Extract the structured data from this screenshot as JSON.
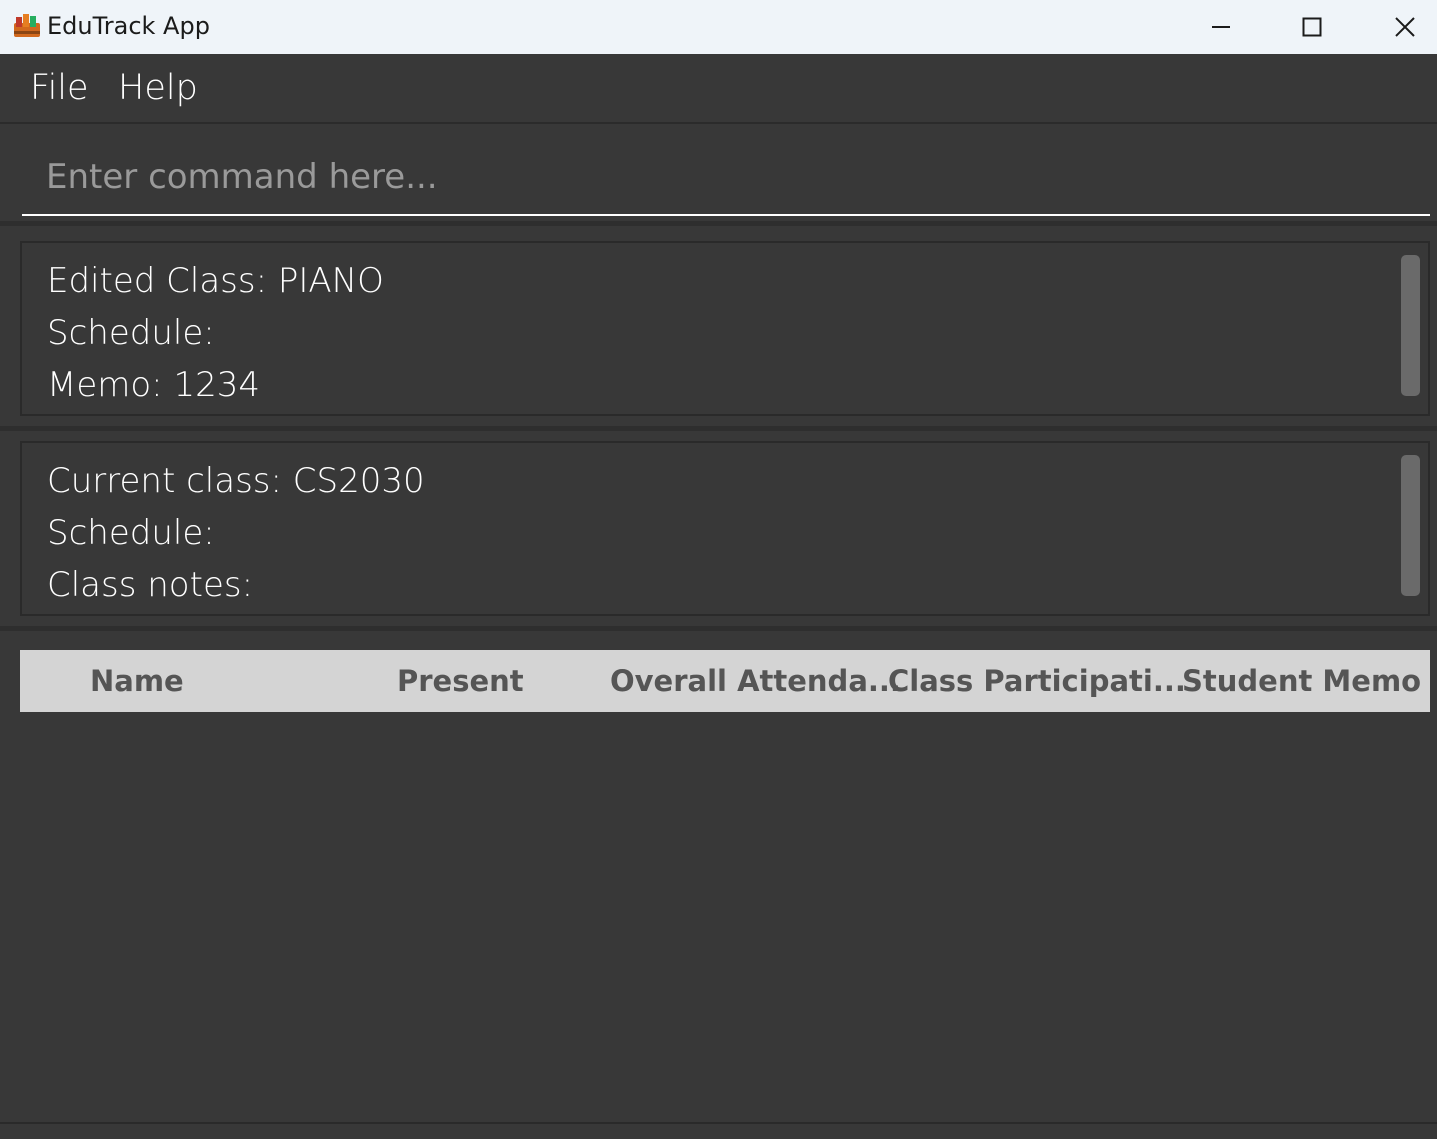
{
  "window": {
    "title": "EduTrack App",
    "icon": "books-icon"
  },
  "menu": {
    "file": "File",
    "help": "Help"
  },
  "command": {
    "placeholder": "Enter command here...",
    "value": ""
  },
  "result": {
    "line1": "Edited Class: PIANO",
    "line2": "Schedule:",
    "line3": "Memo: 1234"
  },
  "class_info": {
    "line1": "Current class: CS2030",
    "line2": "Schedule:",
    "line3": "Class notes:"
  },
  "table": {
    "columns": [
      "Name",
      "Present",
      "Overall Attenda...",
      "Class Participati...",
      "Student Memo"
    ]
  }
}
